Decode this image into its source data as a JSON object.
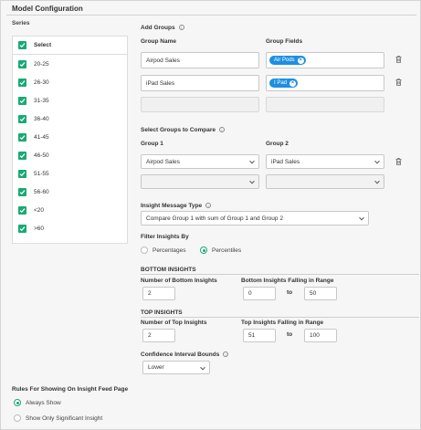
{
  "header": {
    "title": "Model Configuration"
  },
  "series": {
    "label": "Series",
    "select_all_label": "Select",
    "items": [
      "20-25",
      "26-30",
      "31-35",
      "36-40",
      "41-45",
      "46-50",
      "51-55",
      "56-60",
      "<20",
      ">60"
    ]
  },
  "add_groups": {
    "title": "Add Groups",
    "col_name": "Group Name",
    "col_fields": "Group Fields",
    "rows": [
      {
        "name": "Airpod Sales",
        "tag": "Air Pods"
      },
      {
        "name": "iPad Sales",
        "tag": "I Pad"
      },
      {
        "name": "",
        "tag": ""
      }
    ]
  },
  "compare": {
    "title": "Select Groups to Compare",
    "col1": "Group 1",
    "col2": "Group 2",
    "rows": [
      {
        "g1": "Airpod Sales",
        "g2": "iPad Sales"
      },
      {
        "g1": "",
        "g2": ""
      }
    ]
  },
  "insight_type": {
    "title": "Insight Message Type",
    "value": "Compare Group 1 with sum of Group 1 and Group 2"
  },
  "filter": {
    "title": "Filter Insights By",
    "options": [
      "Percentages",
      "Percentiles"
    ],
    "selected": "Percentiles"
  },
  "bottom": {
    "title": "BOTTOM INSIGHTS",
    "count_label": "Number of Bottom Insights",
    "count": "2",
    "range_label": "Bottom Insights Falling in Range",
    "from": "0",
    "to_label": "to",
    "to": "50"
  },
  "top": {
    "title": "TOP INSIGHTS",
    "count_label": "Number of Top Insights",
    "count": "2",
    "range_label": "Top Insights Falling in Range",
    "from": "51",
    "to_label": "to",
    "to": "100"
  },
  "confidence": {
    "title": "Confidence Interval Bounds",
    "value": "Lower"
  },
  "rules": {
    "title": "Rules For Showing On Insight Feed Page",
    "options": [
      "Always Show",
      "Show Only Significant Insight"
    ],
    "selected": "Always Show"
  },
  "colors": {
    "accent": "#19a974",
    "tag": "#1e8fe0"
  }
}
